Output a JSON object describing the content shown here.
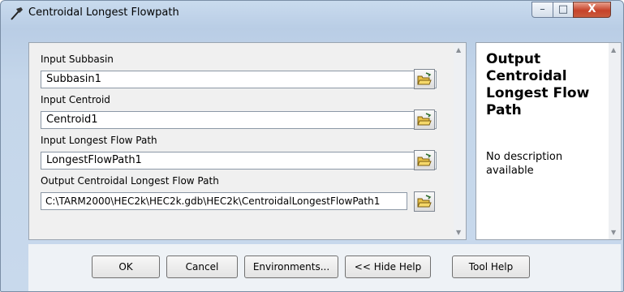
{
  "window": {
    "title": "Centroidal Longest Flowpath",
    "minimize": "–",
    "maximize": "□",
    "close": "X"
  },
  "form": {
    "subbasin": {
      "label": "Input Subbasin",
      "value": "Subbasin1"
    },
    "centroid": {
      "label": "Input Centroid",
      "value": "Centroid1"
    },
    "longest": {
      "label": "Input Longest Flow Path",
      "value": "LongestFlowPath1"
    },
    "output": {
      "label": "Output Centroidal Longest Flow Path",
      "value": "C:\\TARM2000\\HEC2k\\HEC2k.gdb\\HEC2k\\CentroidalLongestFlowPath1"
    }
  },
  "help": {
    "title": "Output Centroidal Longest Flow Path",
    "description": "No description available"
  },
  "buttons": {
    "ok": "OK",
    "cancel": "Cancel",
    "environments": "Environments...",
    "hide_help": "<< Hide Help",
    "tool_help": "Tool Help"
  },
  "icons": {
    "title_icon": "hammer-icon",
    "browse": "open-folder-icon",
    "dropdown": "chevron-down-icon"
  }
}
